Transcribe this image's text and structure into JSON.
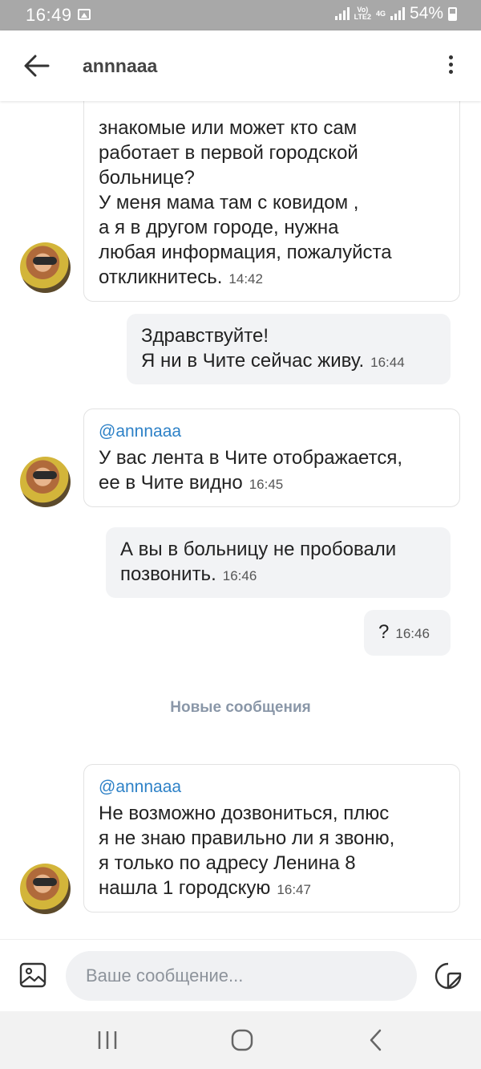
{
  "status_bar": {
    "time": "16:49",
    "network": "4G",
    "lte_label": "LTE2",
    "volte_label": "Vo)",
    "battery": "54%"
  },
  "header": {
    "title": "annnaaa"
  },
  "messages": [
    {
      "direction": "incoming",
      "text_lines": [
        "знакомые или может кто сам",
        "работает в первой городской",
        "больнице?",
        "У меня мама там с ковидом ,",
        "а я в другом городе, нужна",
        "любая информация, пожалуйста",
        "откликнитесь."
      ],
      "time": "14:42"
    },
    {
      "direction": "outgoing",
      "text_lines": [
        "Здравствуйте!",
        "Я ни в Чите сейчас живу."
      ],
      "time": "16:44"
    },
    {
      "direction": "incoming",
      "mention": "@annnaaa",
      "text_lines": [
        "У вас лента в Чите отображается,",
        "ее в Чите видно"
      ],
      "time": "16:45"
    },
    {
      "direction": "outgoing",
      "text_lines": [
        "А вы в больницу не пробовали",
        "позвонить."
      ],
      "time": "16:46"
    },
    {
      "direction": "outgoing",
      "text_lines": [
        "?"
      ],
      "time": "16:46"
    },
    {
      "direction": "incoming",
      "mention": "@annnaaa",
      "text_lines": [
        "Не возможно дозвониться, плюс",
        "я не знаю правильно ли я звоню,",
        "я только по адресу Ленина 8",
        "нашла 1 городскую"
      ],
      "time": "16:47"
    }
  ],
  "divider": {
    "label": "Новые сообщения"
  },
  "composer": {
    "placeholder": "Ваше сообщение..."
  },
  "colors": {
    "mention": "#2d81c7",
    "outgoing_bubble": "#f2f3f5",
    "divider_text": "#8a97a8",
    "status_bar": "#a8a8a8"
  },
  "icons": [
    "back-arrow-icon",
    "more-vertical-icon",
    "gallery-icon",
    "sticker-icon",
    "nav-recents-icon",
    "nav-home-icon",
    "nav-back-icon"
  ]
}
